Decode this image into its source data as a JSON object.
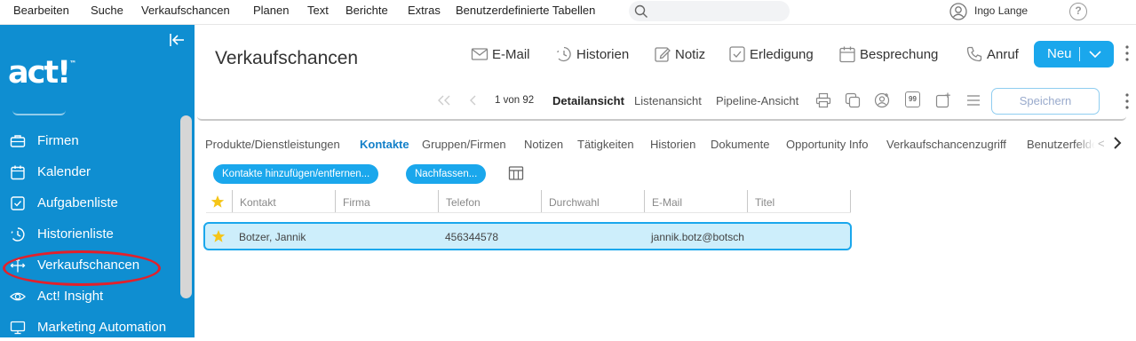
{
  "menu": [
    "Bearbeiten",
    "Suche",
    "Verkaufschancen",
    "Planen",
    "Text",
    "Berichte",
    "Extras",
    "Benutzerdefinierte Tabellen"
  ],
  "user": {
    "name": "Ingo Lange"
  },
  "sidebar": {
    "logo": "act!",
    "logo_tm": "™",
    "items": [
      {
        "label": "Firmen",
        "icon": "briefcase-icon"
      },
      {
        "label": "Kalender",
        "icon": "calendar-icon"
      },
      {
        "label": "Aufgabenliste",
        "icon": "checkbox-icon"
      },
      {
        "label": "Historienliste",
        "icon": "history-icon"
      },
      {
        "label": "Verkaufschancen",
        "icon": "opportunity-icon",
        "highlighted": true
      },
      {
        "label": "Act! Insight",
        "icon": "eye-icon"
      },
      {
        "label": "Marketing Automation",
        "icon": "monitor-icon"
      }
    ]
  },
  "page": {
    "title": "Verkaufschancen"
  },
  "actions": {
    "email": "E-Mail",
    "histories": "Historien",
    "note": "Notiz",
    "task": "Erledigung",
    "meeting": "Besprechung",
    "call": "Anruf",
    "new": "Neu"
  },
  "nav": {
    "record_position": "1 von 92",
    "detail_view": "Detailansicht",
    "list_view": "Listenansicht",
    "pipeline_view": "Pipeline-Ansicht",
    "save": "Speichern",
    "tool_99": "99"
  },
  "tabs": [
    "Produkte/Dienstleistungen",
    "Kontakte",
    "Gruppen/Firmen",
    "Notizen",
    "Tätigkeiten",
    "Historien",
    "Dokumente",
    "Opportunity Info",
    "Verkaufschancenzugriff",
    "Benutzerfelder"
  ],
  "active_tab": "Kontakte",
  "tab_prev": "<",
  "buttons": {
    "add_remove_contacts": "Kontakte hinzufügen/entfernen...",
    "follow_up": "Nachfassen..."
  },
  "table": {
    "columns": [
      "Kontakt",
      "Firma",
      "Telefon",
      "Durchwahl",
      "E-Mail",
      "Titel"
    ],
    "rows": [
      {
        "contact": "Botzer, Jannik",
        "company": "",
        "phone": "456344578",
        "extension": "",
        "email": "jannik.botz@botsch",
        "title": ""
      }
    ]
  },
  "colors": {
    "sidebar": "#0f8ed1",
    "accent": "#1aa7ec",
    "highlight_oval": "#e3202a",
    "selected_row": "#cdeefb",
    "star": "#f5c518"
  }
}
